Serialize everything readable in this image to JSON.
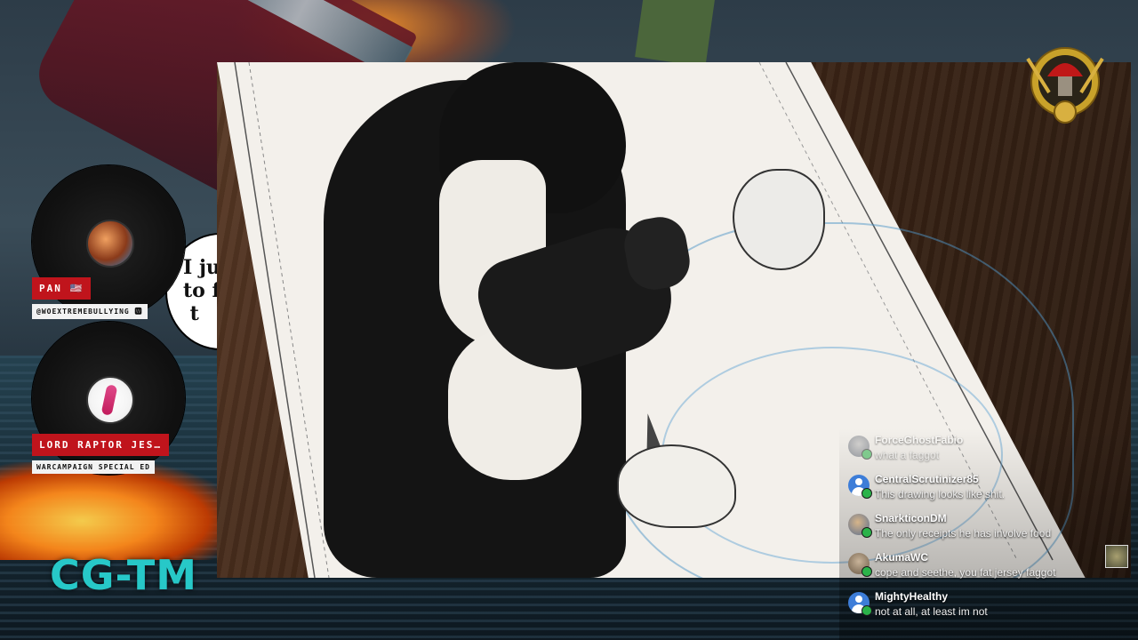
{
  "background": {
    "logo_text": "CG-TM",
    "speech_bubble": "I ju\nto f\n t"
  },
  "guests": [
    {
      "name": "PAN 🇺🇸",
      "handle": "@WOEXTREMEBULLYING 🆆",
      "avatar_icon": "guest-avatar-icon"
    },
    {
      "name": "LORD RAPTOR JES…",
      "handle": "WARCAMPAIGN SPECIAL ED",
      "avatar_icon": "guest-avatar-icon"
    }
  ],
  "chat": {
    "messages": [
      {
        "user": "ForceGhostFabio",
        "text": "what a faggot",
        "faded": true
      },
      {
        "user": "CentralScrutinizer85",
        "text": "This drawing looks like shit."
      },
      {
        "user": "SnarkticonDM",
        "text": "The only receipts he has involve food"
      },
      {
        "user": "AkumaWC",
        "text": "cope and seethe, you fat jersey faggot"
      },
      {
        "user": "MightyHealthy",
        "text": "not at all, at least im not"
      }
    ]
  },
  "colors": {
    "name_tag": "#c0141c",
    "logo_teal": "#27c8c8",
    "verified_green": "#2bb34a"
  }
}
